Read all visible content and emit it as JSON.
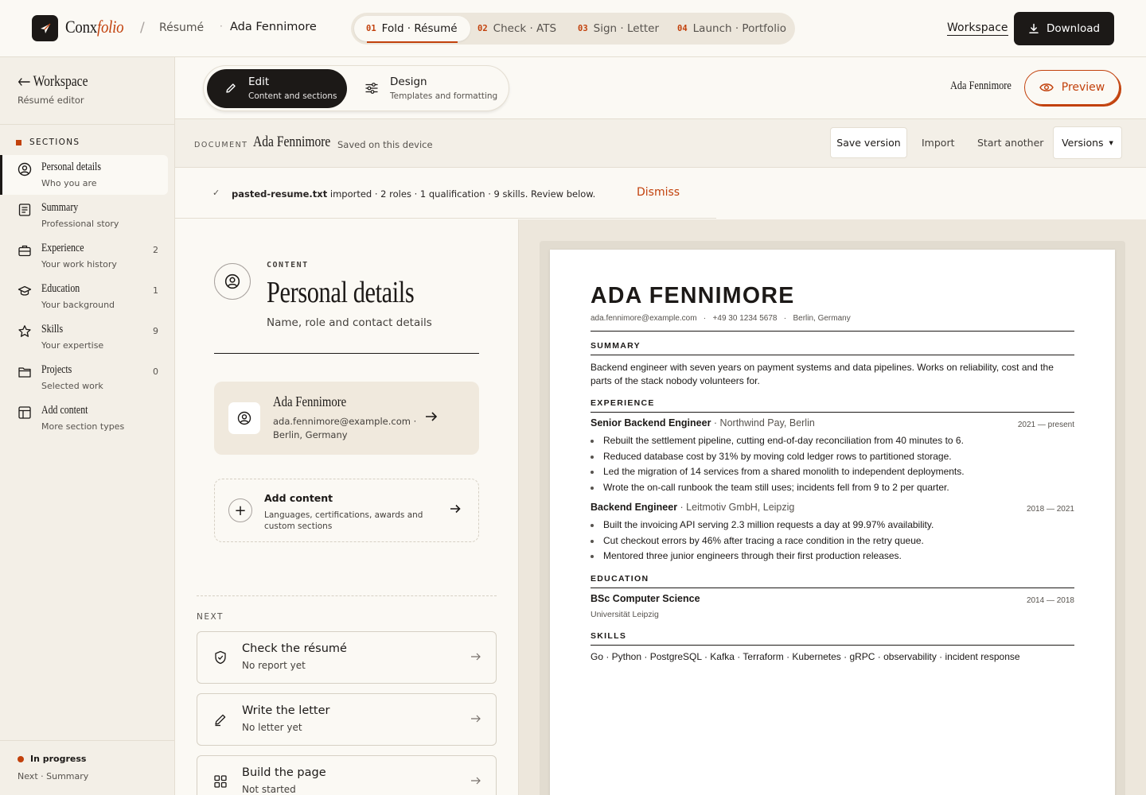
{
  "brand": {
    "name_plain": "Conx",
    "name_italic": "folio"
  },
  "breadcrumb": {
    "separator": "/",
    "item1": "Résumé",
    "dot": "·",
    "item2": "Ada Fennimore"
  },
  "steps": [
    {
      "num": "01",
      "label": "Fold · Résumé",
      "active": true
    },
    {
      "num": "02",
      "label": "Check · ATS",
      "active": false
    },
    {
      "num": "03",
      "label": "Sign · Letter",
      "active": false
    },
    {
      "num": "04",
      "label": "Launch · Portfolio",
      "active": false
    }
  ],
  "topbar": {
    "workspace_label": "Workspace",
    "download_label": "Download"
  },
  "sidebar": {
    "back_label": "Workspace",
    "subtitle": "Résumé editor",
    "sections_heading": "SECTIONS",
    "items": [
      {
        "label": "Personal details",
        "sub": "Who you are",
        "count": "",
        "icon": "user-circle-icon",
        "active": true
      },
      {
        "label": "Summary",
        "sub": "Professional story",
        "count": "",
        "icon": "document-text-icon",
        "active": false
      },
      {
        "label": "Experience",
        "sub": "Your work history",
        "count": "2",
        "icon": "briefcase-icon",
        "active": false
      },
      {
        "label": "Education",
        "sub": "Your background",
        "count": "1",
        "icon": "graduation-cap-icon",
        "active": false
      },
      {
        "label": "Skills",
        "sub": "Your expertise",
        "count": "9",
        "icon": "star-icon",
        "active": false
      },
      {
        "label": "Projects",
        "sub": "Selected work",
        "count": "0",
        "icon": "folder-icon",
        "active": false
      },
      {
        "label": "Add content",
        "sub": "More section types",
        "count": "",
        "icon": "layout-icon",
        "active": false
      }
    ],
    "status": "In progress",
    "next": "Next · Summary"
  },
  "modes": {
    "edit": {
      "title": "Edit",
      "sub": "Content and sections"
    },
    "design": {
      "title": "Design",
      "sub": "Templates and formatting"
    }
  },
  "modebar": {
    "name": "Ada Fennimore",
    "preview_label": "Preview"
  },
  "docbar": {
    "label": "DOCUMENT",
    "name": "Ada Fennimore",
    "saved": "Saved on this device",
    "save_version": "Save version",
    "import": "Import",
    "start_another": "Start another",
    "versions": "Versions"
  },
  "notice": {
    "check": "✓",
    "file": "pasted-resume.txt",
    "text": " imported · 2 roles · 1 qualification · 9 skills. Review below.",
    "dismiss": "Dismiss"
  },
  "editor": {
    "eyebrow": "CONTENT",
    "title": "Personal details",
    "desc": "Name, role and contact details",
    "card": {
      "name": "Ada Fennimore",
      "email": "ada.fennimore@example.com ·",
      "location": "Berlin, Germany"
    },
    "add": {
      "title": "Add content",
      "desc": "Languages, certifications, awards and custom sections"
    },
    "next_label": "NEXT",
    "next_items": [
      {
        "title": "Check the résumé",
        "sub": "No report yet",
        "icon": "shield-check-icon"
      },
      {
        "title": "Write the letter",
        "sub": "No letter yet",
        "icon": "pen-icon"
      },
      {
        "title": "Build the page",
        "sub": "Not started",
        "icon": "grid-icon"
      }
    ]
  },
  "resume": {
    "name": "ADA FENNIMORE",
    "contact": "ada.fennimore@example.com   ·   +49 30 1234 5678   ·   Berlin, Germany",
    "summary_heading": "SUMMARY",
    "summary": "Backend engineer with seven years on payment systems and data pipelines. Works on reliability, cost and the parts of the stack nobody volunteers for.",
    "experience_heading": "EXPERIENCE",
    "jobs": [
      {
        "title": "Senior Backend Engineer",
        "company": " · Northwind Pay, Berlin",
        "dates": "2021 — present",
        "bullets": [
          "Rebuilt the settlement pipeline, cutting end-of-day reconciliation from 40 minutes to 6.",
          "Reduced database cost by 31% by moving cold ledger rows to partitioned storage.",
          "Led the migration of 14 services from a shared monolith to independent deployments.",
          "Wrote the on-call runbook the team still uses; incidents fell from 9 to 2 per quarter."
        ]
      },
      {
        "title": "Backend Engineer",
        "company": " · Leitmotiv GmbH, Leipzig",
        "dates": "2018 — 2021",
        "bullets": [
          "Built the invoicing API serving 2.3 million requests a day at 99.97% availability.",
          "Cut checkout errors by 46% after tracing a race condition in the retry queue.",
          "Mentored three junior engineers through their first production releases."
        ]
      }
    ],
    "education_heading": "EDUCATION",
    "education": {
      "degree": "BSc Computer Science",
      "dates": "2014 — 2018",
      "school": "Universität Leipzig"
    },
    "skills_heading": "SKILLS",
    "skills": "Go · Python · PostgreSQL · Kafka · Terraform · Kubernetes · gRPC · observability · incident response"
  },
  "colors": {
    "accent": "#c2410c",
    "ink": "#1c1917",
    "paper": "#fbf9f4",
    "sidebar": "#f3efe7"
  }
}
